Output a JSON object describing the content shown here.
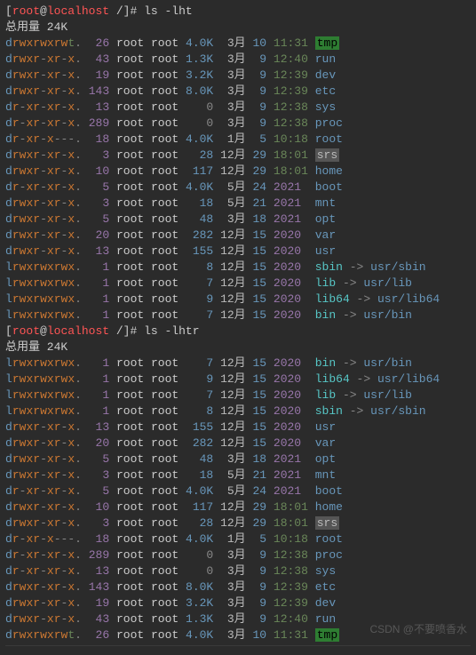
{
  "watermark": "CSDN @不要喷香水",
  "blocks": [
    {
      "prompt": {
        "user": "root",
        "host": "localhost",
        "path": "/",
        "symbol": "#",
        "cmd": "ls -lht"
      },
      "total_label": "总用量 24K",
      "rows": [
        {
          "perm": "drwxrwxrwt.",
          "nlink": 26,
          "owner": "root",
          "group": "root",
          "size": "4.0K",
          "mon": "3月",
          "day": "10",
          "ytime": "11:31",
          "name": "tmp",
          "kind": "tmp"
        },
        {
          "perm": "drwxr-xr-x.",
          "nlink": 43,
          "owner": "root",
          "group": "root",
          "size": "1.3K",
          "mon": "3月",
          "day": "9",
          "ytime": "12:40",
          "name": "run",
          "kind": "dir"
        },
        {
          "perm": "drwxr-xr-x.",
          "nlink": 19,
          "owner": "root",
          "group": "root",
          "size": "3.2K",
          "mon": "3月",
          "day": "9",
          "ytime": "12:39",
          "name": "dev",
          "kind": "dir"
        },
        {
          "perm": "drwxr-xr-x.",
          "nlink": 143,
          "owner": "root",
          "group": "root",
          "size": "8.0K",
          "mon": "3月",
          "day": "9",
          "ytime": "12:39",
          "name": "etc",
          "kind": "dir"
        },
        {
          "perm": "dr-xr-xr-x.",
          "nlink": 13,
          "owner": "root",
          "group": "root",
          "size": "0",
          "mon": "3月",
          "day": "9",
          "ytime": "12:38",
          "name": "sys",
          "kind": "dir"
        },
        {
          "perm": "dr-xr-xr-x.",
          "nlink": 289,
          "owner": "root",
          "group": "root",
          "size": "0",
          "mon": "3月",
          "day": "9",
          "ytime": "12:38",
          "name": "proc",
          "kind": "dir"
        },
        {
          "perm": "dr-xr-x---.",
          "nlink": 18,
          "owner": "root",
          "group": "root",
          "size": "4.0K",
          "mon": "1月",
          "day": "5",
          "ytime": "10:18",
          "name": "root",
          "kind": "dir"
        },
        {
          "perm": "drwxr-xr-x.",
          "nlink": 3,
          "owner": "root",
          "group": "root",
          "size": "28",
          "mon": "12月",
          "day": "29",
          "ytime": "18:01",
          "name": "srs",
          "kind": "srs"
        },
        {
          "perm": "drwxr-xr-x.",
          "nlink": 10,
          "owner": "root",
          "group": "root",
          "size": "117",
          "mon": "12月",
          "day": "29",
          "ytime": "18:01",
          "name": "home",
          "kind": "dir"
        },
        {
          "perm": "dr-xr-xr-x.",
          "nlink": 5,
          "owner": "root",
          "group": "root",
          "size": "4.0K",
          "mon": "5月",
          "day": "24",
          "ytime": "2021",
          "name": "boot",
          "kind": "dir"
        },
        {
          "perm": "drwxr-xr-x.",
          "nlink": 3,
          "owner": "root",
          "group": "root",
          "size": "18",
          "mon": "5月",
          "day": "21",
          "ytime": "2021",
          "name": "mnt",
          "kind": "dir"
        },
        {
          "perm": "drwxr-xr-x.",
          "nlink": 5,
          "owner": "root",
          "group": "root",
          "size": "48",
          "mon": "3月",
          "day": "18",
          "ytime": "2021",
          "name": "opt",
          "kind": "dir"
        },
        {
          "perm": "drwxr-xr-x.",
          "nlink": 20,
          "owner": "root",
          "group": "root",
          "size": "282",
          "mon": "12月",
          "day": "15",
          "ytime": "2020",
          "name": "var",
          "kind": "dir"
        },
        {
          "perm": "drwxr-xr-x.",
          "nlink": 13,
          "owner": "root",
          "group": "root",
          "size": "155",
          "mon": "12月",
          "day": "15",
          "ytime": "2020",
          "name": "usr",
          "kind": "dir"
        },
        {
          "perm": "lrwxrwxrwx.",
          "nlink": 1,
          "owner": "root",
          "group": "root",
          "size": "8",
          "mon": "12月",
          "day": "15",
          "ytime": "2020",
          "name": "sbin",
          "kind": "link",
          "target": "usr/sbin"
        },
        {
          "perm": "lrwxrwxrwx.",
          "nlink": 1,
          "owner": "root",
          "group": "root",
          "size": "7",
          "mon": "12月",
          "day": "15",
          "ytime": "2020",
          "name": "lib",
          "kind": "link",
          "target": "usr/lib"
        },
        {
          "perm": "lrwxrwxrwx.",
          "nlink": 1,
          "owner": "root",
          "group": "root",
          "size": "9",
          "mon": "12月",
          "day": "15",
          "ytime": "2020",
          "name": "lib64",
          "kind": "link",
          "target": "usr/lib64"
        },
        {
          "perm": "lrwxrwxrwx.",
          "nlink": 1,
          "owner": "root",
          "group": "root",
          "size": "7",
          "mon": "12月",
          "day": "15",
          "ytime": "2020",
          "name": "bin",
          "kind": "link",
          "target": "usr/bin"
        }
      ]
    },
    {
      "prompt": {
        "user": "root",
        "host": "localhost",
        "path": "/",
        "symbol": "#",
        "cmd": "ls -lhtr"
      },
      "total_label": "总用量 24K",
      "rows": [
        {
          "perm": "lrwxrwxrwx.",
          "nlink": 1,
          "owner": "root",
          "group": "root",
          "size": "7",
          "mon": "12月",
          "day": "15",
          "ytime": "2020",
          "name": "bin",
          "kind": "link",
          "target": "usr/bin"
        },
        {
          "perm": "lrwxrwxrwx.",
          "nlink": 1,
          "owner": "root",
          "group": "root",
          "size": "9",
          "mon": "12月",
          "day": "15",
          "ytime": "2020",
          "name": "lib64",
          "kind": "link",
          "target": "usr/lib64"
        },
        {
          "perm": "lrwxrwxrwx.",
          "nlink": 1,
          "owner": "root",
          "group": "root",
          "size": "7",
          "mon": "12月",
          "day": "15",
          "ytime": "2020",
          "name": "lib",
          "kind": "link",
          "target": "usr/lib"
        },
        {
          "perm": "lrwxrwxrwx.",
          "nlink": 1,
          "owner": "root",
          "group": "root",
          "size": "8",
          "mon": "12月",
          "day": "15",
          "ytime": "2020",
          "name": "sbin",
          "kind": "link",
          "target": "usr/sbin"
        },
        {
          "perm": "drwxr-xr-x.",
          "nlink": 13,
          "owner": "root",
          "group": "root",
          "size": "155",
          "mon": "12月",
          "day": "15",
          "ytime": "2020",
          "name": "usr",
          "kind": "dir"
        },
        {
          "perm": "drwxr-xr-x.",
          "nlink": 20,
          "owner": "root",
          "group": "root",
          "size": "282",
          "mon": "12月",
          "day": "15",
          "ytime": "2020",
          "name": "var",
          "kind": "dir"
        },
        {
          "perm": "drwxr-xr-x.",
          "nlink": 5,
          "owner": "root",
          "group": "root",
          "size": "48",
          "mon": "3月",
          "day": "18",
          "ytime": "2021",
          "name": "opt",
          "kind": "dir"
        },
        {
          "perm": "drwxr-xr-x.",
          "nlink": 3,
          "owner": "root",
          "group": "root",
          "size": "18",
          "mon": "5月",
          "day": "21",
          "ytime": "2021",
          "name": "mnt",
          "kind": "dir"
        },
        {
          "perm": "dr-xr-xr-x.",
          "nlink": 5,
          "owner": "root",
          "group": "root",
          "size": "4.0K",
          "mon": "5月",
          "day": "24",
          "ytime": "2021",
          "name": "boot",
          "kind": "dir"
        },
        {
          "perm": "drwxr-xr-x.",
          "nlink": 10,
          "owner": "root",
          "group": "root",
          "size": "117",
          "mon": "12月",
          "day": "29",
          "ytime": "18:01",
          "name": "home",
          "kind": "dir"
        },
        {
          "perm": "drwxr-xr-x.",
          "nlink": 3,
          "owner": "root",
          "group": "root",
          "size": "28",
          "mon": "12月",
          "day": "29",
          "ytime": "18:01",
          "name": "srs",
          "kind": "srs"
        },
        {
          "perm": "dr-xr-x---.",
          "nlink": 18,
          "owner": "root",
          "group": "root",
          "size": "4.0K",
          "mon": "1月",
          "day": "5",
          "ytime": "10:18",
          "name": "root",
          "kind": "dir"
        },
        {
          "perm": "dr-xr-xr-x.",
          "nlink": 289,
          "owner": "root",
          "group": "root",
          "size": "0",
          "mon": "3月",
          "day": "9",
          "ytime": "12:38",
          "name": "proc",
          "kind": "dir"
        },
        {
          "perm": "dr-xr-xr-x.",
          "nlink": 13,
          "owner": "root",
          "group": "root",
          "size": "0",
          "mon": "3月",
          "day": "9",
          "ytime": "12:38",
          "name": "sys",
          "kind": "dir"
        },
        {
          "perm": "drwxr-xr-x.",
          "nlink": 143,
          "owner": "root",
          "group": "root",
          "size": "8.0K",
          "mon": "3月",
          "day": "9",
          "ytime": "12:39",
          "name": "etc",
          "kind": "dir"
        },
        {
          "perm": "drwxr-xr-x.",
          "nlink": 19,
          "owner": "root",
          "group": "root",
          "size": "3.2K",
          "mon": "3月",
          "day": "9",
          "ytime": "12:39",
          "name": "dev",
          "kind": "dir"
        },
        {
          "perm": "drwxr-xr-x.",
          "nlink": 43,
          "owner": "root",
          "group": "root",
          "size": "1.3K",
          "mon": "3月",
          "day": "9",
          "ytime": "12:40",
          "name": "run",
          "kind": "dir"
        },
        {
          "perm": "drwxrwxrwt.",
          "nlink": 26,
          "owner": "root",
          "group": "root",
          "size": "4.0K",
          "mon": "3月",
          "day": "10",
          "ytime": "11:31",
          "name": "tmp",
          "kind": "tmp"
        }
      ]
    }
  ]
}
